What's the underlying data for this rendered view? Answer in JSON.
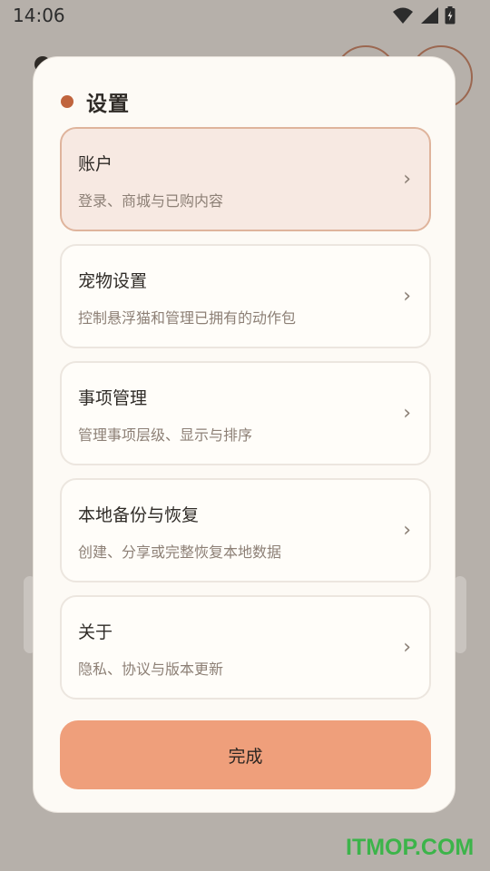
{
  "status_bar": {
    "time": "14:06",
    "icons": [
      "wifi-icon",
      "signal-icon",
      "battery-charging-icon"
    ]
  },
  "settings": {
    "title": "设置",
    "accent_color": "#c0643d",
    "items": [
      {
        "label": "账户",
        "description": "登录、商城与已购内容",
        "chevron": "›",
        "active": true
      },
      {
        "label": "宠物设置",
        "description": "控制悬浮猫和管理已拥有的动作包",
        "chevron": "›",
        "active": false
      },
      {
        "label": "事项管理",
        "description": "管理事项层级、显示与排序",
        "chevron": "›",
        "active": false
      },
      {
        "label": "本地备份与恢复",
        "description": "创建、分享或完整恢复本地数据",
        "chevron": "›",
        "active": false
      },
      {
        "label": "关于",
        "description": "隐私、协议与版本更新",
        "chevron": "›",
        "active": false
      }
    ],
    "done_label": "完成",
    "done_color": "#ef9f7b"
  },
  "watermark": "ITMOP.COM"
}
